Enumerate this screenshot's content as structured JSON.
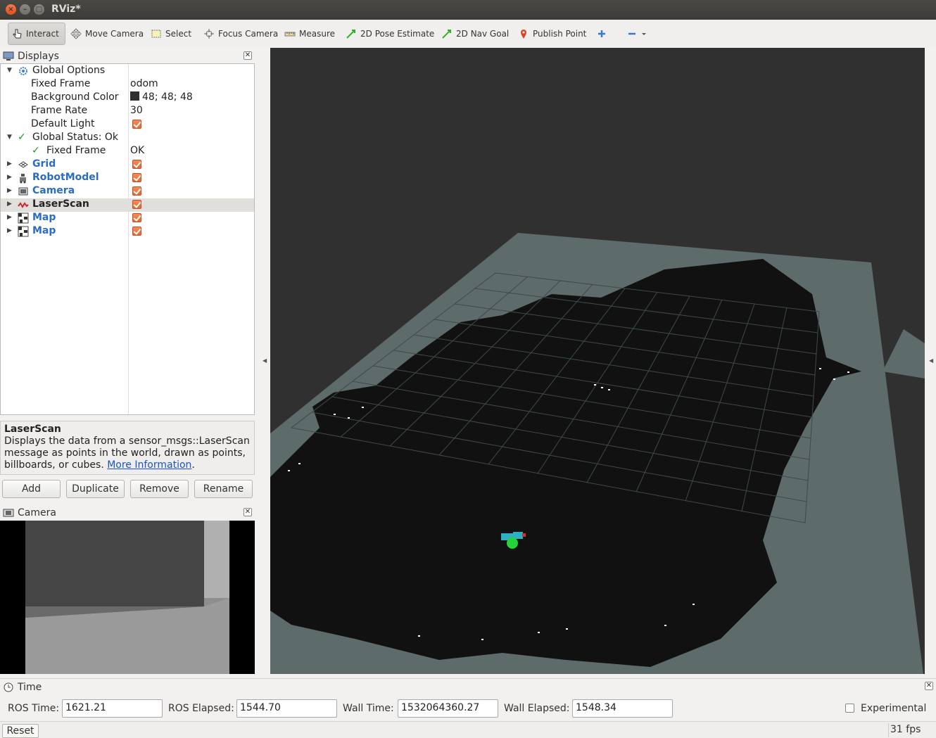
{
  "window": {
    "title": "RViz*"
  },
  "toolbar": {
    "tools": [
      {
        "label": "Interact",
        "icon": "hand-pointer-icon"
      },
      {
        "label": "Move Camera",
        "icon": "move-arrows-icon"
      },
      {
        "label": "Select",
        "icon": "select-rectangle-icon"
      },
      {
        "label": "Focus Camera",
        "icon": "focus-crosshair-icon"
      },
      {
        "label": "Measure",
        "icon": "ruler-icon"
      },
      {
        "label": "2D Pose Estimate",
        "icon": "green-arrow-icon"
      },
      {
        "label": "2D Nav Goal",
        "icon": "green-arrow-icon"
      },
      {
        "label": "Publish Point",
        "icon": "map-pin-icon"
      }
    ]
  },
  "displays": {
    "title": "Displays",
    "rows": [
      {
        "label": "Global Options",
        "value": ""
      },
      {
        "label": "Fixed Frame",
        "value": "odom"
      },
      {
        "label": "Background Color",
        "value": "48; 48; 48"
      },
      {
        "label": "Frame Rate",
        "value": "30"
      },
      {
        "label": "Default Light",
        "value": ""
      },
      {
        "label": "Global Status: Ok",
        "value": ""
      },
      {
        "label": "Fixed Frame",
        "value": "OK"
      },
      {
        "label": "Grid",
        "value": ""
      },
      {
        "label": "RobotModel",
        "value": ""
      },
      {
        "label": "Camera",
        "value": ""
      },
      {
        "label": "LaserScan",
        "value": ""
      },
      {
        "label": "Map",
        "value": ""
      },
      {
        "label": "Map",
        "value": ""
      }
    ],
    "description": {
      "title": "LaserScan",
      "text": "Displays the data from a sensor_msgs::LaserScan message as points in the world, drawn as points, billboards, or cubes.",
      "link": "More Information",
      "link_suffix": "."
    },
    "buttons": {
      "add": "Add",
      "duplicate": "Duplicate",
      "remove": "Remove",
      "rename": "Rename"
    }
  },
  "camera_panel": {
    "title": "Camera"
  },
  "time_panel": {
    "title": "Time",
    "ros_time_label": "ROS Time:",
    "ros_time": "1621.21",
    "ros_elapsed_label": "ROS Elapsed:",
    "ros_elapsed": "1544.70",
    "wall_time_label": "Wall Time:",
    "wall_time": "1532064360.27",
    "wall_elapsed_label": "Wall Elapsed:",
    "wall_elapsed": "1548.34",
    "experimental_label": "Experimental"
  },
  "status": {
    "reset_label": "Reset",
    "fps": "31 fps"
  },
  "colors": {
    "background": "#303030",
    "accent_blue": "#2b6cc4",
    "checkbox": "#e8672e",
    "map_floor": "#5d6b6a"
  }
}
